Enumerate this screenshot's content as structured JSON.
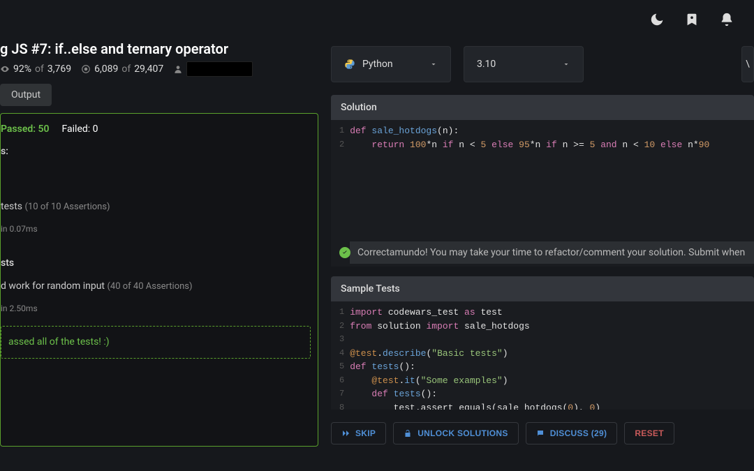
{
  "topbar": {
    "icons": [
      "moon-icon",
      "bookmark-icon",
      "bell-icon"
    ]
  },
  "kata": {
    "title": "g JS #7: if..else and ternary operator",
    "satisfaction_pct": "92%",
    "satisfaction_of": "of",
    "satisfaction_total": "3,769",
    "completions": "6,089",
    "completions_of": "of",
    "completions_total": "29,407"
  },
  "output_tab": "Output",
  "results": {
    "passed_label": "Passed: 50",
    "failed_label": "Failed: 0",
    "heading_suffix": "s:",
    "basic_tests_label": "tests",
    "basic_assertions": "(10 of 10 Assertions)",
    "basic_time": "in 0.07ms",
    "random_heading": "sts",
    "random_label": "d work for random input",
    "random_assertions": "(40 of 40 Assertions)",
    "random_time": "in 2.50ms",
    "all_passed": "assed all of the tests! :)"
  },
  "selectors": {
    "language": "Python",
    "version": "3.10",
    "right_char": "\\"
  },
  "solution": {
    "header": "Solution",
    "lines": [
      "1",
      "2"
    ],
    "code_html": [
      "<span class='kw'>def</span> <span class='fn'>sale_hotdogs</span>(n):",
      "    <span class='kw'>return</span> <span class='num'>100</span>*n <span class='kw'>if</span> n &lt; <span class='num'>5</span> <span class='kw'>else</span> <span class='num'>95</span>*n <span class='kw'>if</span> n &gt;= <span class='num'>5</span> <span class='kw'>and</span> n &lt; <span class='num'>10</span> <span class='kw'>else</span> n*<span class='num'>90</span>"
    ]
  },
  "banner": "Correctamundo! You may take your time to refactor/comment your solution. Submit when",
  "tests": {
    "header": "Sample Tests",
    "lines": [
      "1",
      "2",
      "3",
      "4",
      "5",
      "6",
      "7",
      "8"
    ],
    "code_html": [
      "<span class='kw'>import</span> codewars_test <span class='kw'>as</span> test",
      "<span class='kw'>from</span> solution <span class='kw'>import</span> sale_hotdogs",
      "",
      "<span class='op'>@test</span>.<span class='fn'>describe</span>(<span class='str'>\"Basic tests\"</span>)",
      "<span class='kw'>def</span> <span class='fn'>tests</span>():",
      "    <span class='op'>@test</span>.<span class='fn'>it</span>(<span class='str'>\"Some examples\"</span>)",
      "    <span class='kw'>def</span> <span class='fn'>tests</span>():",
      "        test.assert_equals(sale_hotdogs(<span class='num'>0</span>), <span class='num'>0</span>)"
    ]
  },
  "actions": {
    "skip": "SKIP",
    "unlock": "UNLOCK SOLUTIONS",
    "discuss": "DISCUSS (29)",
    "reset": "RESET"
  }
}
